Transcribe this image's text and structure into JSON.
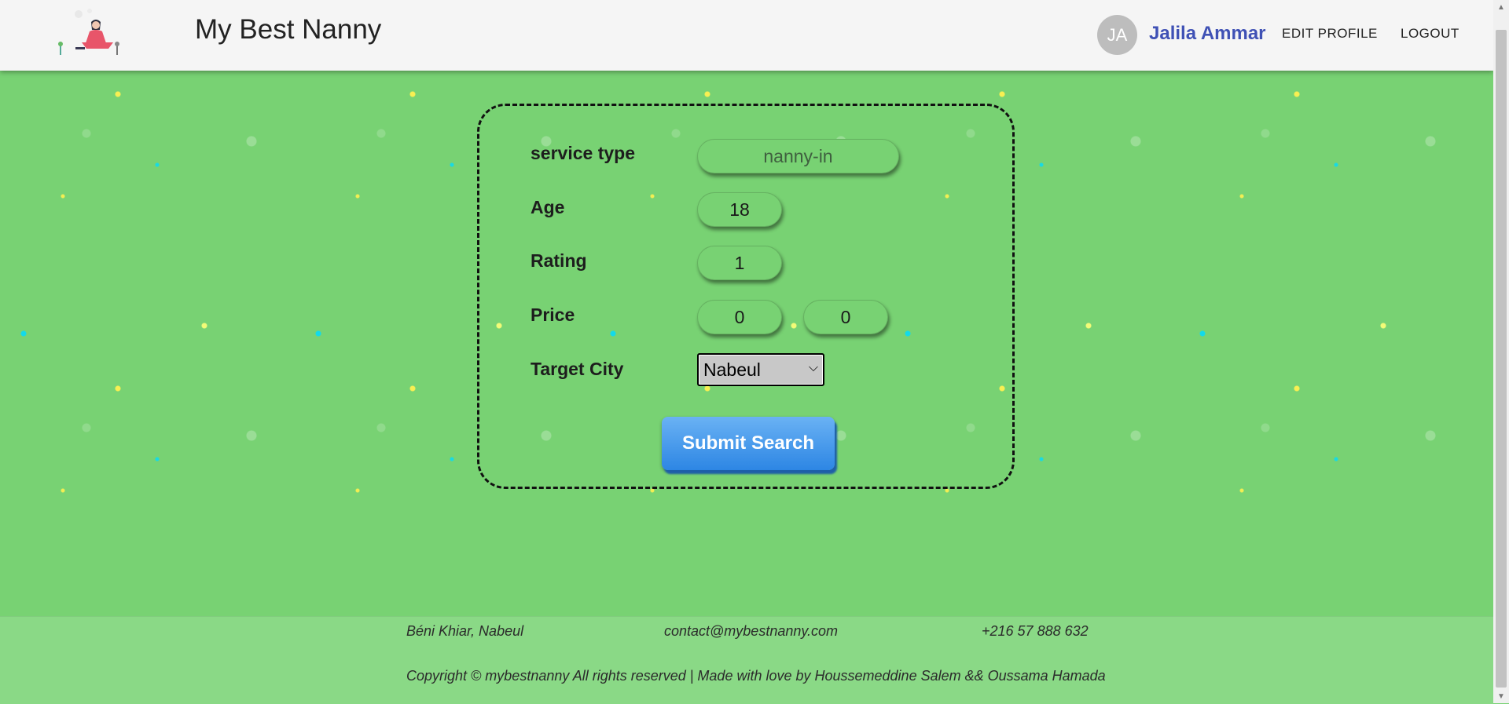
{
  "header": {
    "site_title": "My Best Nanny",
    "avatar_initials": "JA",
    "username": "Jalila Ammar",
    "edit_profile": "EDIT PROFILE",
    "logout": "LOGOUT"
  },
  "form": {
    "service_type_label": "service type",
    "service_type_value": "nanny-in",
    "age_label": "Age",
    "age_value": "18",
    "rating_label": "Rating",
    "rating_value": "1",
    "price_label": "Price",
    "price_min": "0",
    "price_max": "0",
    "city_label": "Target City",
    "city_selected": "Nabeul",
    "submit_label": "Submit Search"
  },
  "footer": {
    "address": "Béni Khiar, Nabeul",
    "email": "contact@mybestnanny.com",
    "phone": "+216 57 888 632",
    "copyright": "Copyright © mybestnanny All rights reserved | Made with love by Houssemeddine Salem && Oussama Hamada"
  },
  "colors": {
    "background": "#78d273",
    "header_bg": "#f5f5f5",
    "username": "#3f51b5",
    "submit_button": "#3b8fe8"
  }
}
